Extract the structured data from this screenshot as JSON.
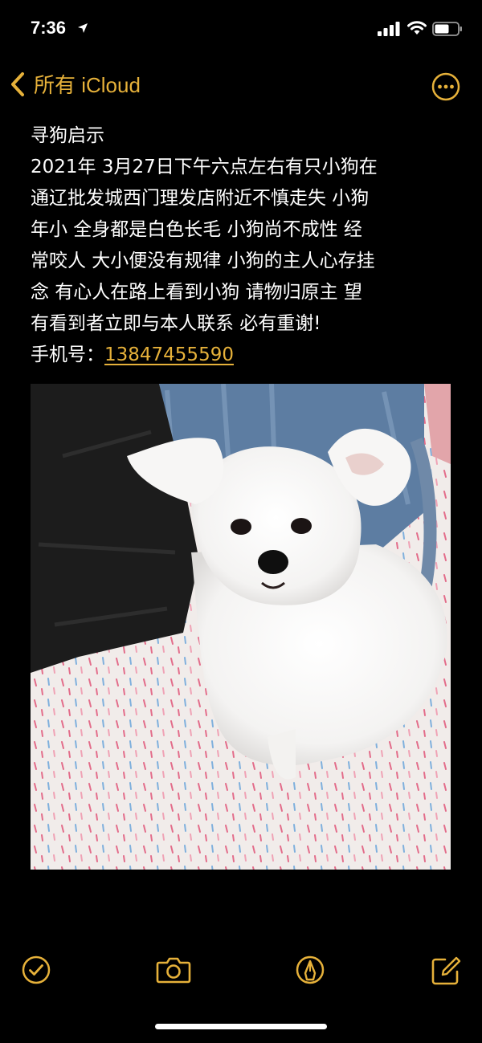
{
  "status_bar": {
    "time": "7:36"
  },
  "nav": {
    "back_label": "所有 iCloud"
  },
  "note": {
    "lines": [
      "寻狗启示",
      "2021年 3月27日下午六点左右有只小狗在",
      "通辽批发城西门理发店附近不慎走失 小狗",
      "年小 全身都是白色长毛 小狗尚不成性 经",
      "常咬人 大小便没有规律 小狗的主人心存挂",
      "念 有心人在路上看到小狗 请物归原主 望",
      "有看到者立即与本人联系 必有重谢!"
    ],
    "phone_label": "手机号：",
    "phone_number": "13847455590"
  },
  "colors": {
    "accent": "#e6b13a",
    "background": "#000000",
    "text": "#ffffff"
  },
  "icons": [
    "location-arrow-icon",
    "signal-icon",
    "wifi-icon",
    "battery-icon",
    "chevron-left-icon",
    "more-icon",
    "checklist-icon",
    "camera-icon",
    "markup-icon",
    "compose-icon"
  ]
}
